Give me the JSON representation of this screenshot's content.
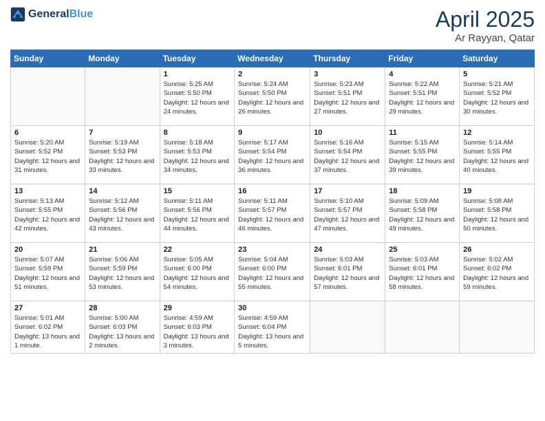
{
  "header": {
    "logo_line1": "General",
    "logo_line2": "Blue",
    "month": "April 2025",
    "location": "Ar Rayyan, Qatar"
  },
  "weekdays": [
    "Sunday",
    "Monday",
    "Tuesday",
    "Wednesday",
    "Thursday",
    "Friday",
    "Saturday"
  ],
  "weeks": [
    [
      {
        "day": "",
        "info": ""
      },
      {
        "day": "",
        "info": ""
      },
      {
        "day": "1",
        "info": "Sunrise: 5:25 AM\nSunset: 5:50 PM\nDaylight: 12 hours and 24 minutes."
      },
      {
        "day": "2",
        "info": "Sunrise: 5:24 AM\nSunset: 5:50 PM\nDaylight: 12 hours and 26 minutes."
      },
      {
        "day": "3",
        "info": "Sunrise: 5:23 AM\nSunset: 5:51 PM\nDaylight: 12 hours and 27 minutes."
      },
      {
        "day": "4",
        "info": "Sunrise: 5:22 AM\nSunset: 5:51 PM\nDaylight: 12 hours and 29 minutes."
      },
      {
        "day": "5",
        "info": "Sunrise: 5:21 AM\nSunset: 5:52 PM\nDaylight: 12 hours and 30 minutes."
      }
    ],
    [
      {
        "day": "6",
        "info": "Sunrise: 5:20 AM\nSunset: 5:52 PM\nDaylight: 12 hours and 31 minutes."
      },
      {
        "day": "7",
        "info": "Sunrise: 5:19 AM\nSunset: 5:53 PM\nDaylight: 12 hours and 33 minutes."
      },
      {
        "day": "8",
        "info": "Sunrise: 5:18 AM\nSunset: 5:53 PM\nDaylight: 12 hours and 34 minutes."
      },
      {
        "day": "9",
        "info": "Sunrise: 5:17 AM\nSunset: 5:54 PM\nDaylight: 12 hours and 36 minutes."
      },
      {
        "day": "10",
        "info": "Sunrise: 5:16 AM\nSunset: 5:54 PM\nDaylight: 12 hours and 37 minutes."
      },
      {
        "day": "11",
        "info": "Sunrise: 5:15 AM\nSunset: 5:55 PM\nDaylight: 12 hours and 39 minutes."
      },
      {
        "day": "12",
        "info": "Sunrise: 5:14 AM\nSunset: 5:55 PM\nDaylight: 12 hours and 40 minutes."
      }
    ],
    [
      {
        "day": "13",
        "info": "Sunrise: 5:13 AM\nSunset: 5:55 PM\nDaylight: 12 hours and 42 minutes."
      },
      {
        "day": "14",
        "info": "Sunrise: 5:12 AM\nSunset: 5:56 PM\nDaylight: 12 hours and 43 minutes."
      },
      {
        "day": "15",
        "info": "Sunrise: 5:11 AM\nSunset: 5:56 PM\nDaylight: 12 hours and 44 minutes."
      },
      {
        "day": "16",
        "info": "Sunrise: 5:11 AM\nSunset: 5:57 PM\nDaylight: 12 hours and 46 minutes."
      },
      {
        "day": "17",
        "info": "Sunrise: 5:10 AM\nSunset: 5:57 PM\nDaylight: 12 hours and 47 minutes."
      },
      {
        "day": "18",
        "info": "Sunrise: 5:09 AM\nSunset: 5:58 PM\nDaylight: 12 hours and 49 minutes."
      },
      {
        "day": "19",
        "info": "Sunrise: 5:08 AM\nSunset: 5:58 PM\nDaylight: 12 hours and 50 minutes."
      }
    ],
    [
      {
        "day": "20",
        "info": "Sunrise: 5:07 AM\nSunset: 5:59 PM\nDaylight: 12 hours and 51 minutes."
      },
      {
        "day": "21",
        "info": "Sunrise: 5:06 AM\nSunset: 5:59 PM\nDaylight: 12 hours and 53 minutes."
      },
      {
        "day": "22",
        "info": "Sunrise: 5:05 AM\nSunset: 6:00 PM\nDaylight: 12 hours and 54 minutes."
      },
      {
        "day": "23",
        "info": "Sunrise: 5:04 AM\nSunset: 6:00 PM\nDaylight: 12 hours and 55 minutes."
      },
      {
        "day": "24",
        "info": "Sunrise: 5:03 AM\nSunset: 6:01 PM\nDaylight: 12 hours and 57 minutes."
      },
      {
        "day": "25",
        "info": "Sunrise: 5:03 AM\nSunset: 6:01 PM\nDaylight: 12 hours and 58 minutes."
      },
      {
        "day": "26",
        "info": "Sunrise: 5:02 AM\nSunset: 6:02 PM\nDaylight: 12 hours and 59 minutes."
      }
    ],
    [
      {
        "day": "27",
        "info": "Sunrise: 5:01 AM\nSunset: 6:02 PM\nDaylight: 13 hours and 1 minute."
      },
      {
        "day": "28",
        "info": "Sunrise: 5:00 AM\nSunset: 6:03 PM\nDaylight: 13 hours and 2 minutes."
      },
      {
        "day": "29",
        "info": "Sunrise: 4:59 AM\nSunset: 6:03 PM\nDaylight: 13 hours and 3 minutes."
      },
      {
        "day": "30",
        "info": "Sunrise: 4:59 AM\nSunset: 6:04 PM\nDaylight: 13 hours and 5 minutes."
      },
      {
        "day": "",
        "info": ""
      },
      {
        "day": "",
        "info": ""
      },
      {
        "day": "",
        "info": ""
      }
    ]
  ]
}
